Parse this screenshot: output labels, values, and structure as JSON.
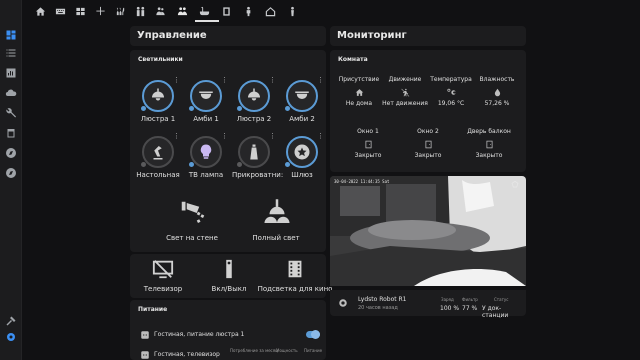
{
  "topbar": {
    "tabs": [
      "home-icon",
      "keyboard-icon",
      "tv-remote-icon",
      "fan-icon",
      "garland-icon",
      "family-icon",
      "people-icon",
      "bathtub-icon",
      "robot-vacuum-icon",
      "kid-icon",
      "house-icon",
      "person-icon"
    ],
    "active_index": 6
  },
  "sidebar": {
    "icons": [
      "dashboard-icon",
      "logbook-icon",
      "history-icon",
      "cloud-icon",
      "wrench-icon",
      "calendar-icon",
      "compass-icon",
      "compass-icon-2"
    ],
    "bottom_icons": [
      "hammer-icon",
      "settings-icon"
    ]
  },
  "left": {
    "header": "Управление",
    "lights_card": {
      "title": "Светильники",
      "lights": [
        {
          "label": "Люстра 1",
          "on": true
        },
        {
          "label": "Амби 1",
          "on": true
        },
        {
          "label": "Люстра 2",
          "on": true
        },
        {
          "label": "Амби 2",
          "on": true
        },
        {
          "label": "Настольная",
          "on": false
        },
        {
          "label": "ТВ лампа",
          "on": true
        },
        {
          "label": "Прикроватни:",
          "on": false
        },
        {
          "label": "Шлюз",
          "on": true
        }
      ],
      "big_buttons": [
        "Свет на стене",
        "Полный свет"
      ]
    },
    "tv_card": {
      "buttons": [
        "Телевизор",
        "Вкл/Выкл",
        "Подсветка для кино"
      ]
    },
    "power_card": {
      "title": "Питание",
      "rows": [
        {
          "name": "Гостиная, питание люстра 1"
        },
        {
          "name": "Гостиная, телевизор",
          "col1": "Потребление за месяц",
          "col2": "Мощность",
          "col3": "Питание"
        }
      ]
    }
  },
  "right": {
    "header": "Мониторинг",
    "room_card": {
      "title": "Комната",
      "sensors_row1": [
        {
          "name": "Присутствие",
          "value": "Не дома"
        },
        {
          "name": "Движение",
          "value": "Нет движения"
        },
        {
          "name": "Температура",
          "value": "19,06 °C"
        },
        {
          "name": "Влажность",
          "value": "57,26 %"
        }
      ],
      "sensors_row2": [
        {
          "name": "Окно 1",
          "value": "Закрыто"
        },
        {
          "name": "Окно 2",
          "value": "Закрыто"
        },
        {
          "name": "Дверь балкон",
          "value": "Закрыто"
        }
      ]
    },
    "camera": {
      "timestamp": "30-04-2022 11:44:35 Sat"
    },
    "vacuum": {
      "name": "Lydsto Robot R1",
      "ago": "20 часов назад",
      "stats": [
        {
          "label": "Заряд",
          "value": "100 %"
        },
        {
          "label": "Фильтр",
          "value": "77 %"
        },
        {
          "label": "Статус",
          "value": "У док-станции"
        }
      ]
    }
  }
}
